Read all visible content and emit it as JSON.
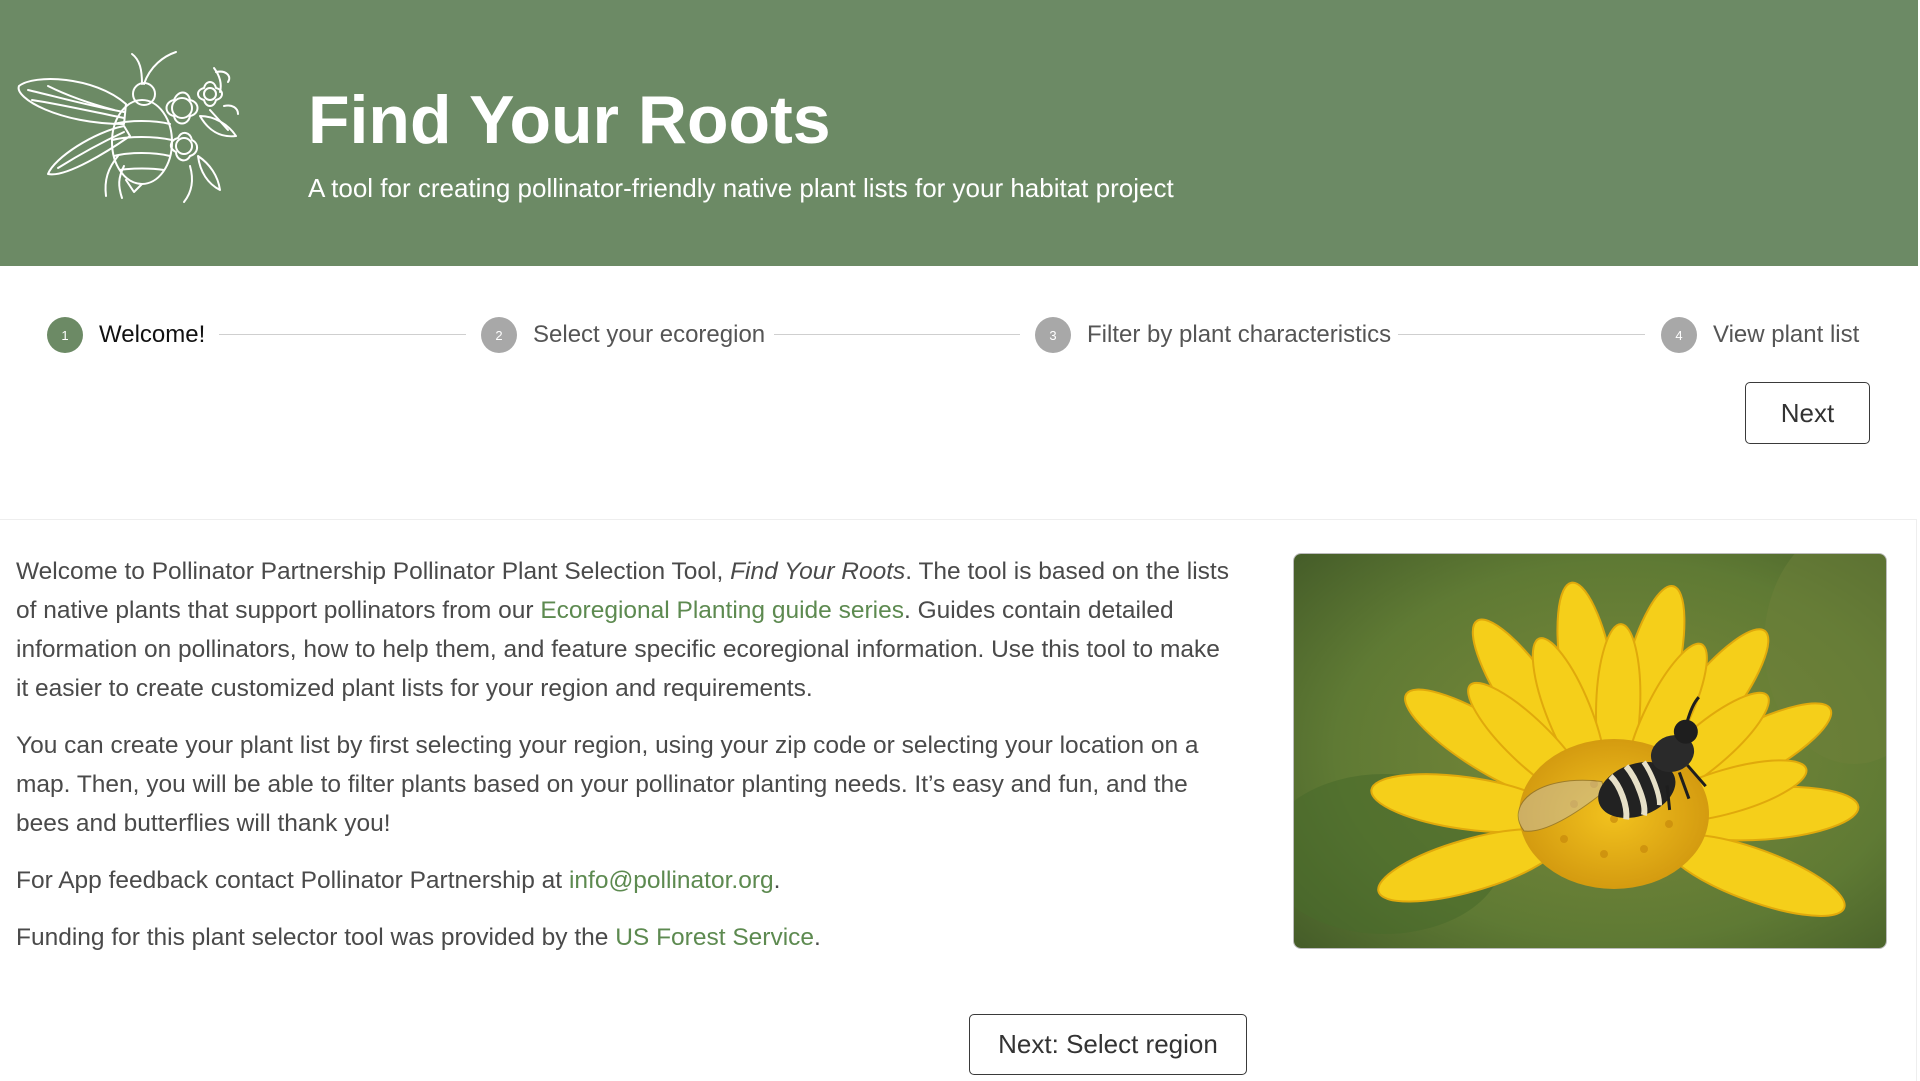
{
  "header": {
    "title": "Find Your Roots",
    "subtitle": "A tool for creating pollinator-friendly native plant lists for your habitat project",
    "logo_icon": "bee-with-flowers-icon",
    "background_color": "#6c8a65"
  },
  "stepper": {
    "steps": [
      {
        "number": "1",
        "label": "Welcome!",
        "active": true
      },
      {
        "number": "2",
        "label": "Select your ecoregion",
        "active": false
      },
      {
        "number": "3",
        "label": "Filter by plant characteristics",
        "active": false
      },
      {
        "number": "4",
        "label": "View plant list",
        "active": false
      }
    ],
    "active_color": "#6c8a65",
    "inactive_color": "#a8a8a8"
  },
  "nav": {
    "next_label": "Next",
    "next_region_label": "Next: Select region"
  },
  "content": {
    "p1_a": "Welcome to Pollinator Partnership Pollinator Plant Selection Tool, ",
    "p1_italic": "Find Your Roots",
    "p1_b": ". The tool is based on the lists of native plants that support pollinators from our ",
    "p1_link": "Ecoregional Planting guide series",
    "p1_c": ". Guides contain detailed information on pollinators, how to help them, and feature specific ecoregional information. Use this tool to make it easier to create customized plant lists for your region and requirements.",
    "p2": "You can create your plant list by first selecting your region, using your zip code or selecting your location on a map. Then, you will be able to filter plants based on your pollinator planting needs. It’s easy and fun, and the bees and butterflies will thank you!",
    "p3_a": "For App feedback contact Pollinator Partnership at ",
    "p3_link": "info@pollinator.org",
    "p3_b": ".",
    "p4_a": "Funding for this plant selector tool was provided by the ",
    "p4_link": "US Forest Service",
    "p4_b": ".",
    "link_color": "#5d8a50",
    "image_subject": "bee-on-yellow-flower-photo"
  }
}
